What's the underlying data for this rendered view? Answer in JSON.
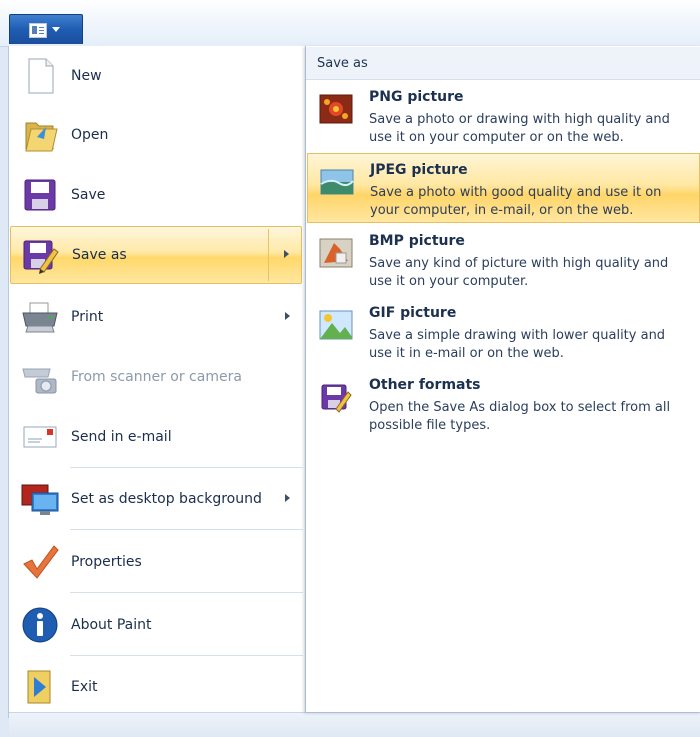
{
  "title_bar": {},
  "menu": {
    "items": [
      {
        "label": "New",
        "icon": "new-document-icon"
      },
      {
        "label": "Open",
        "icon": "open-folder-icon"
      },
      {
        "label": "Save",
        "icon": "floppy-disk-icon"
      },
      {
        "label": "Save as",
        "icon": "save-as-icon"
      },
      {
        "label": "Print",
        "icon": "printer-icon"
      },
      {
        "label": "From scanner or camera",
        "icon": "scanner-camera-icon"
      },
      {
        "label": "Send in e-mail",
        "icon": "email-envelope-icon"
      },
      {
        "label": "Set as desktop background",
        "icon": "desktop-monitor-icon"
      },
      {
        "label": "Properties",
        "icon": "checkmark-icon"
      },
      {
        "label": "About Paint",
        "icon": "info-icon"
      },
      {
        "label": "Exit",
        "icon": "exit-door-icon"
      }
    ]
  },
  "save_as_panel": {
    "header": "Save as",
    "options": [
      {
        "title": "PNG picture",
        "description": "Save a photo or drawing with high quality and use it on your computer or on the web.",
        "icon": "png-picture-icon"
      },
      {
        "title": "JPEG picture",
        "description": "Save a photo with good quality and use it on your computer, in e-mail, or on the web.",
        "icon": "jpeg-picture-icon"
      },
      {
        "title": "BMP picture",
        "description": "Save any kind of picture with high quality and use it on your computer.",
        "icon": "bmp-picture-icon"
      },
      {
        "title": "GIF picture",
        "description": "Save a simple drawing with lower quality and use it in e-mail or on the web.",
        "icon": "gif-picture-icon"
      },
      {
        "title": "Other formats",
        "description": "Open the Save As dialog box to select from all possible file types.",
        "icon": "other-formats-icon"
      }
    ]
  },
  "colors": {
    "highlight": "#ffd86a",
    "app_button": "#1f5db2",
    "text": "#1b2e4c",
    "disabled_text": "#8d9aab"
  }
}
